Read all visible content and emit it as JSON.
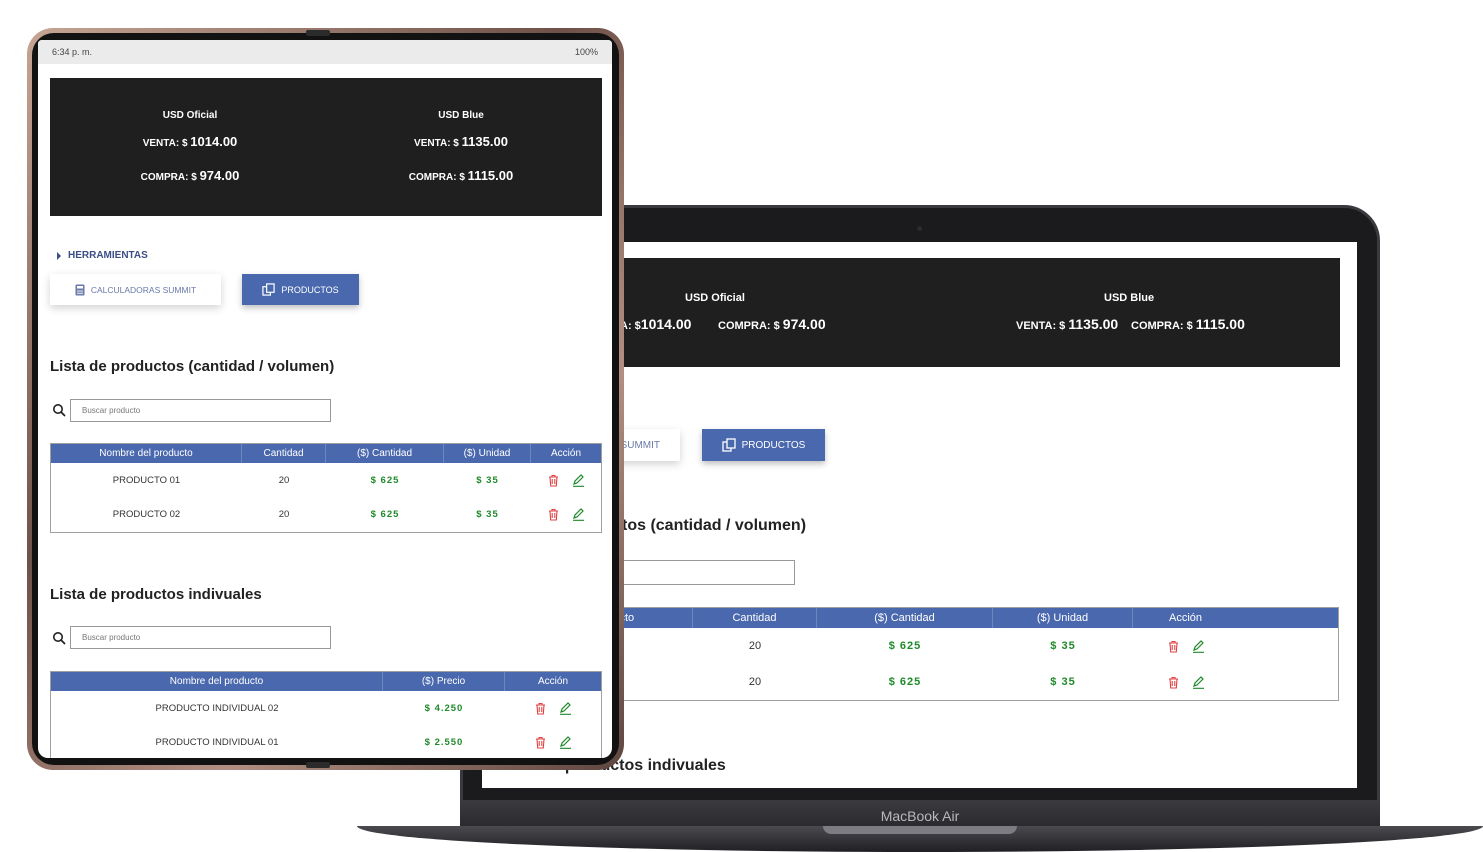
{
  "status": {
    "time": "6:34 p. m.",
    "battery": "100%"
  },
  "rates": {
    "oficial": {
      "title": "USD Oficial",
      "venta_label": "VENTA: $",
      "venta_value": "1014.00",
      "compra_label": "COMPRA: $",
      "compra_value": "974.00"
    },
    "blue": {
      "title": "USD Blue",
      "venta_label": "VENTA: $",
      "venta_value": "1135.00",
      "compra_label": "COMPRA: $",
      "compra_value": "1115.00"
    }
  },
  "tools": {
    "label": "HERRAMIENTAS",
    "calc_button": "CALCULADORAS SUMMIT",
    "products_button": "PRODUCTOS"
  },
  "list_volume": {
    "title": "Lista de productos (cantidad / volumen)",
    "search_placeholder": "Buscar producto",
    "columns": [
      "Nombre del producto",
      "Cantidad",
      "($) Cantidad",
      "($) Unidad",
      "Acción"
    ],
    "rows": [
      {
        "name": "PRODUCTO 01",
        "qty": "20",
        "price_qty": "$ 625",
        "price_unit": "$ 35"
      },
      {
        "name": "PRODUCTO 02",
        "qty": "20",
        "price_qty": "$ 625",
        "price_unit": "$ 35"
      }
    ]
  },
  "list_individual": {
    "title": "Lista de productos indivuales",
    "search_placeholder": "Buscar producto",
    "columns": [
      "Nombre del producto",
      "($) Precio",
      "Acción"
    ],
    "rows": [
      {
        "name": "PRODUCTO INDIVIDUAL 02",
        "price": "$ 4.250"
      },
      {
        "name": "PRODUCTO INDIVIDUAL 01",
        "price": "$ 2.550"
      }
    ]
  },
  "laptop": {
    "label": "MacBook Air",
    "calc_button_visible": "SUMMIT",
    "heading_visible": "tos (cantidad / volumen)",
    "heading2_visible": "Lista de productos indivuales",
    "rate_oficial_venta_visible": "A: $",
    "col0_visible": "re del producto",
    "row0_visible": "ODUCTO 01",
    "row1_visible": "ODUCTO 02"
  },
  "colors": {
    "accent": "#4a68ae",
    "dark_panel": "#1f1f20",
    "money": "#1f8a2a",
    "delete": "#e04040"
  }
}
